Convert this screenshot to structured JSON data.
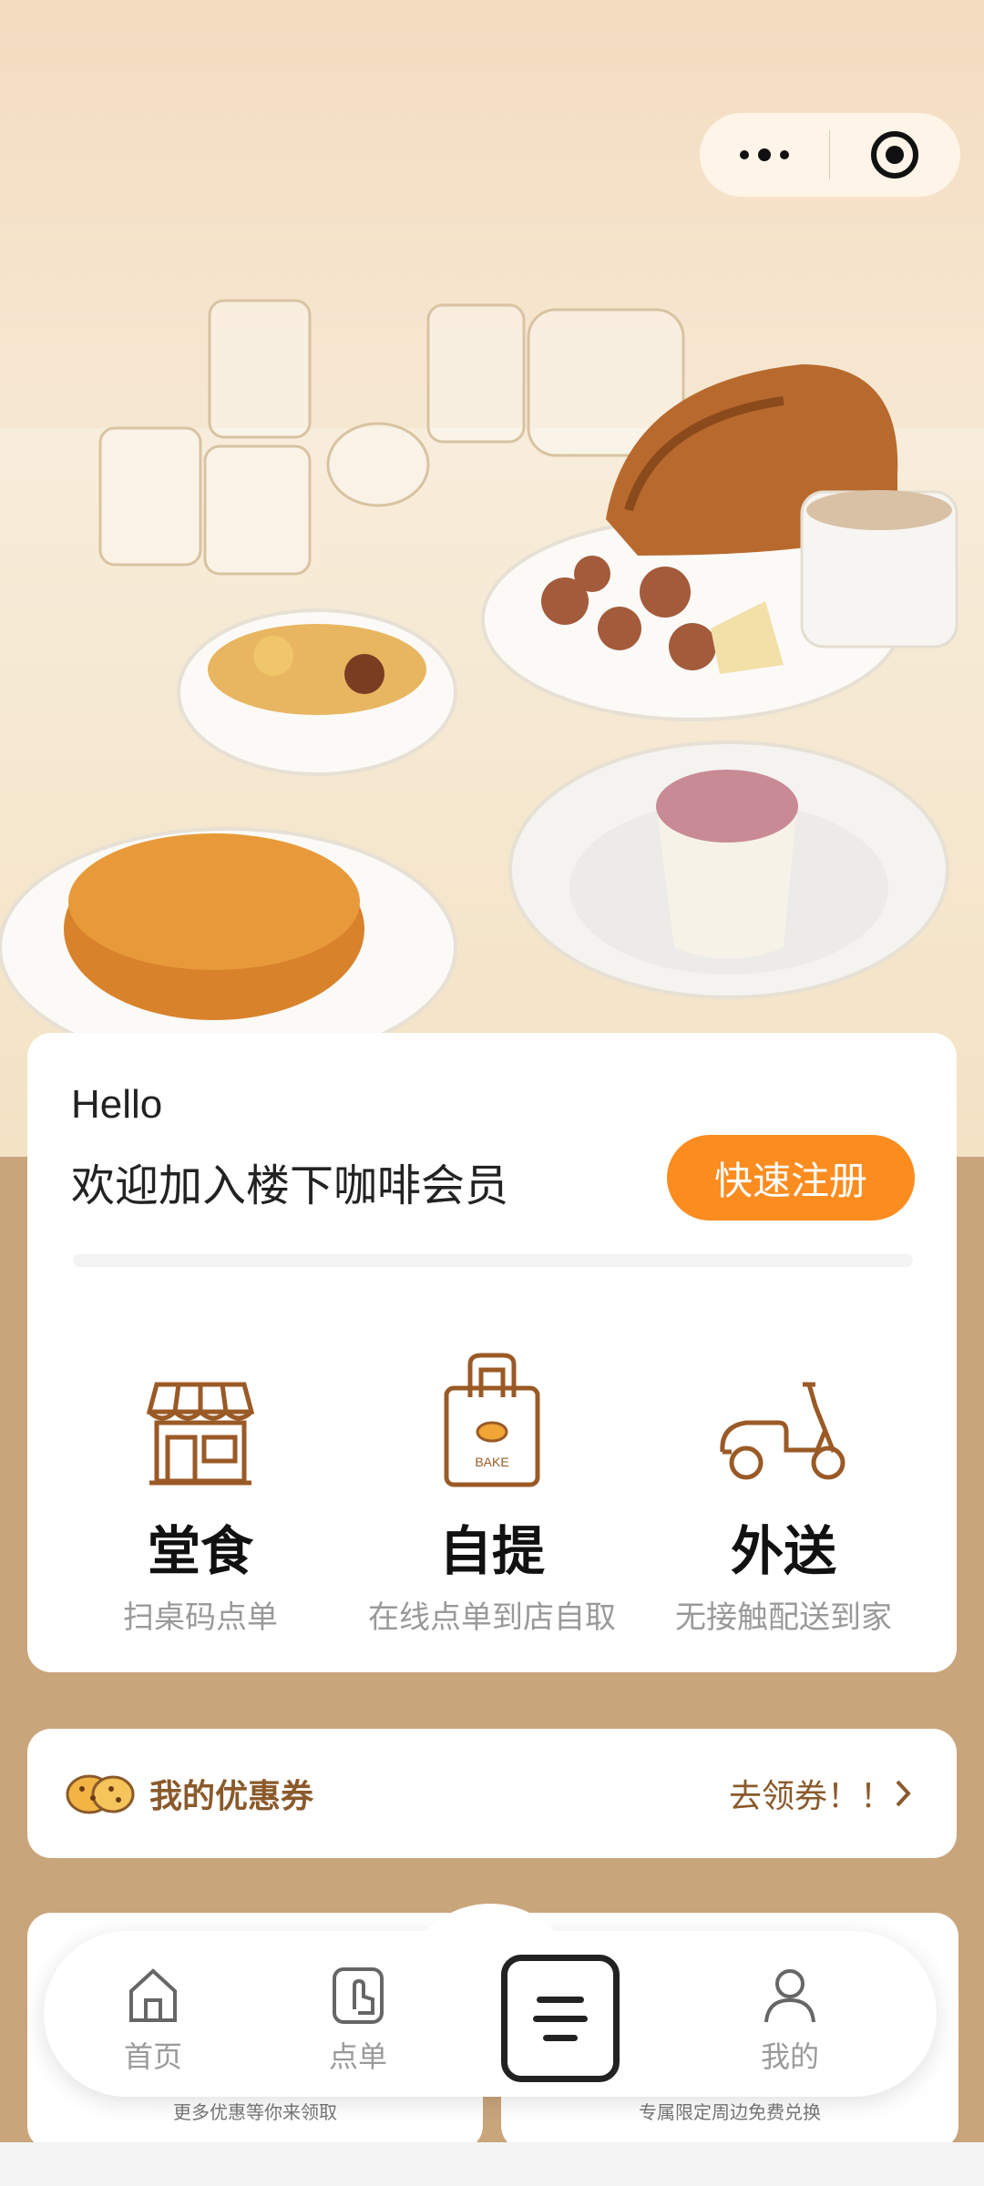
{
  "header": {
    "menu_icon": "more-dots-icon",
    "close_icon": "target-icon"
  },
  "member": {
    "greeting": "Hello",
    "welcome": "欢迎加入楼下咖啡会员",
    "register_label": "快速注册"
  },
  "services": [
    {
      "name": "堂食",
      "desc": "扫桌码点单",
      "icon": "store-icon"
    },
    {
      "name": "自提",
      "desc": "在线点单到店自取",
      "icon": "bake-bag-icon",
      "bag_text": "BAKE"
    },
    {
      "name": "外送",
      "desc": "无接触配送到家",
      "icon": "scooter-icon"
    }
  ],
  "coupon": {
    "title": "我的优惠券",
    "link": "去领券！！"
  },
  "promos": [
    {
      "caption": "更多优惠等你来领取"
    },
    {
      "caption": "专属限定周边免费兑换"
    }
  ],
  "tabs": [
    {
      "label": "首页",
      "icon": "home-icon"
    },
    {
      "label": "点单",
      "icon": "tap-order-icon"
    },
    {
      "label": "",
      "icon": "menu-list-icon"
    },
    {
      "label": "我的",
      "icon": "profile-icon"
    }
  ],
  "colors": {
    "accent": "#fb8c1f",
    "brown": "#8a5a2b",
    "background": "#c9a57c"
  }
}
